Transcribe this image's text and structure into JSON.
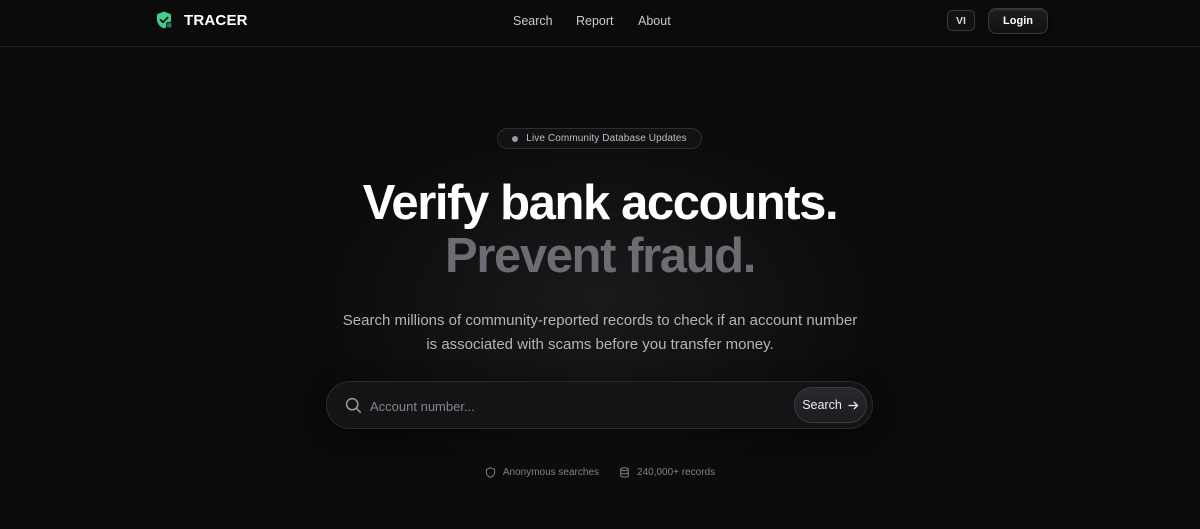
{
  "nav": {
    "brand": "TRACER",
    "links": {
      "search": "Search",
      "report": "Report",
      "about": "About"
    },
    "language": "VI",
    "login": "Login"
  },
  "hero": {
    "badge": "Live Community Database Updates",
    "headline_line1": "Verify bank accounts.",
    "headline_line2": "Prevent fraud.",
    "subtitle": "Search millions of community-reported records to check if an account number is associated with scams before you transfer money."
  },
  "search": {
    "placeholder": "Account number...",
    "value": "",
    "button_label": "Search"
  },
  "footnotes": {
    "anonymous": "Anonymous searches",
    "records": "240,000+ records"
  },
  "colors": {
    "background": "#0b0b0c",
    "brand_accent": "#3ecf8e",
    "headline_primary": "#ffffff",
    "headline_secondary": "#6c6c72"
  },
  "icons": {
    "brand": "shield-check-icon",
    "search": "search-icon",
    "arrow": "arrow-right-icon",
    "anonymous": "shield-icon",
    "records": "database-icon"
  }
}
